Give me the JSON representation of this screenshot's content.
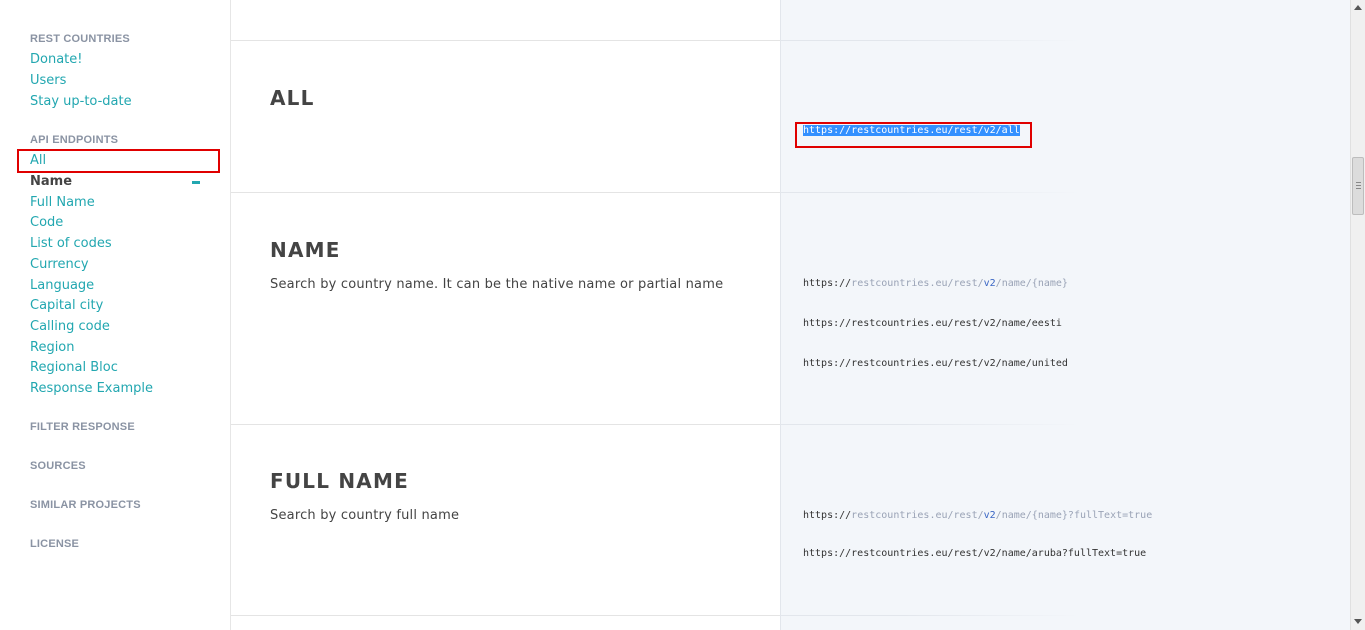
{
  "sidebar": {
    "section_rest": "REST COUNTRIES",
    "rest_links": [
      "Donate!",
      "Users",
      "Stay up-to-date"
    ],
    "section_api": "API ENDPOINTS",
    "api_links": [
      "All",
      "Name",
      "Full Name",
      "Code",
      "List of codes",
      "Currency",
      "Language",
      "Capital city",
      "Calling code",
      "Region",
      "Regional Bloc",
      "Response Example"
    ],
    "active_link": "Name",
    "section_filter": "FILTER RESPONSE",
    "section_sources": "SOURCES",
    "section_similar": "SIMILAR PROJECTS",
    "section_license": "LICENSE"
  },
  "sections": {
    "all": {
      "title": "ALL",
      "url": "https://restcountries.eu/rest/v2/all"
    },
    "name": {
      "title": "NAME",
      "desc": "Search by country name. It can be the native name or partial name",
      "template": {
        "p1": "https://",
        "p2": "restcountries.eu/rest/",
        "p3": "v2",
        "p4": "/name/{name}"
      },
      "example1": "https://restcountries.eu/rest/v2/name/eesti",
      "example2": "https://restcountries.eu/rest/v2/name/united"
    },
    "fullname": {
      "title": "FULL NAME",
      "desc": "Search by country full name",
      "template": {
        "p1": "https://",
        "p2": "restcountries.eu/rest/",
        "p3": "v2",
        "p4": "/name/{name}",
        "p5": "?fullText=true"
      },
      "example1": "https://restcountries.eu/rest/v2/name/aruba?fullText=true"
    }
  },
  "colors": {
    "link": "#22a7b0",
    "highlight_box": "#e00000",
    "selection": "#3390ff",
    "code_panel_bg": "#f3f6fa"
  }
}
